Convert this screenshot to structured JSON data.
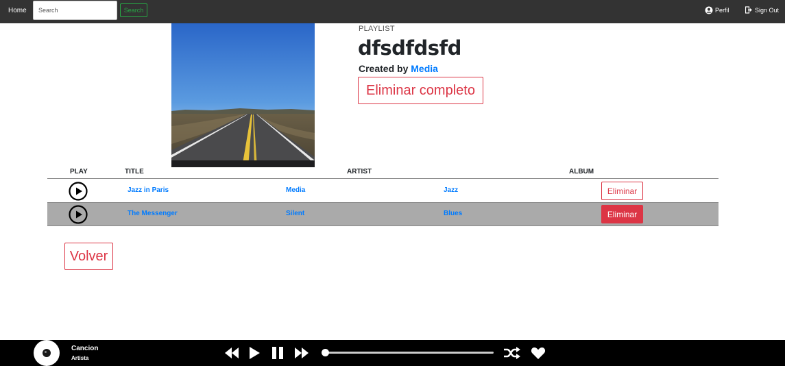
{
  "nav": {
    "home": "Home",
    "search_placeholder": "Search",
    "search_button": "Search",
    "profile": "Perfil",
    "signout": "Sign Out"
  },
  "playlist": {
    "kind": "PLAYLIST",
    "title": "dfsdfdsfd",
    "created_by_prefix": "Created by ",
    "creator": "Media",
    "delete_all": "Eliminar completo"
  },
  "table": {
    "headers": [
      "PLAY",
      "TITLE",
      "ARTIST",
      "ALBUM"
    ],
    "rows": [
      {
        "title": "Jazz in Paris",
        "artist": "Media",
        "album": "Jazz",
        "action": "Eliminar"
      },
      {
        "title": "The Messenger",
        "artist": "Silent",
        "album": "Blues",
        "action": "Eliminar"
      }
    ]
  },
  "back": "Volver",
  "player": {
    "song": "Cancion",
    "artist": "Artista",
    "progress_fraction": 0.0
  },
  "colors": {
    "nav_bg": "#333333",
    "accent_link": "#007bff",
    "danger": "#dc3545",
    "success": "#28a745",
    "row_highlight": "#aaaaaa",
    "player_bg": "#000000"
  },
  "icons": {
    "profile": "user-circle-icon",
    "signout": "sign-out-icon",
    "play_row": "play-circle-icon",
    "rewind": "rewind-icon",
    "play": "play-icon",
    "pause": "pause-icon",
    "forward": "fast-forward-icon",
    "shuffle": "shuffle-icon",
    "like": "heart-icon"
  }
}
